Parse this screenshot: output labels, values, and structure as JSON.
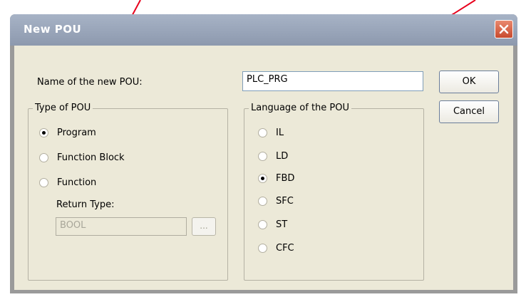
{
  "dialog": {
    "title": "New POU",
    "name_label": "Name of the new POU:",
    "name_value": "PLC_PRG",
    "ok_label": "OK",
    "cancel_label": "Cancel"
  },
  "type_group": {
    "title": "Type of POU",
    "options": [
      {
        "label": "Program",
        "checked": true
      },
      {
        "label": "Function Block",
        "checked": false
      },
      {
        "label": "Function",
        "checked": false
      }
    ],
    "return_type_label": "Return Type:",
    "return_type_value": "BOOL",
    "browse_label": "..."
  },
  "language_group": {
    "title": "Language of the POU",
    "options": [
      {
        "label": "IL",
        "checked": false
      },
      {
        "label": "LD",
        "checked": false
      },
      {
        "label": "FBD",
        "checked": true
      },
      {
        "label": "SFC",
        "checked": false
      },
      {
        "label": "ST",
        "checked": false
      },
      {
        "label": "CFC",
        "checked": false
      }
    ]
  },
  "annotation": {
    "arrow_color": "#e8001c"
  },
  "colors": {
    "dialog_bg": "#ece9d8",
    "titlebar": "#9aa6bb",
    "close": "#d9603f"
  }
}
